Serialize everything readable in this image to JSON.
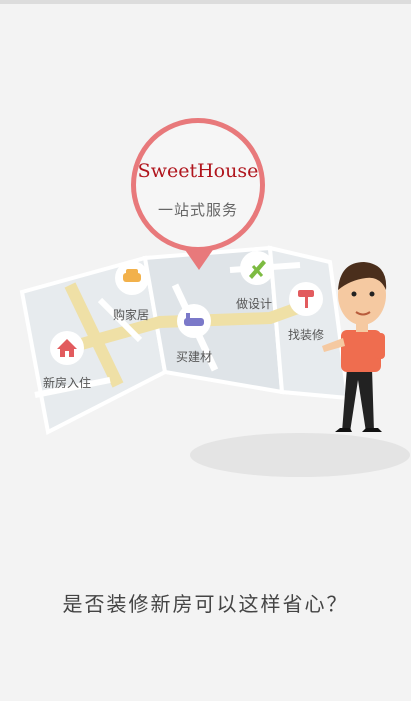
{
  "brand": {
    "title": "SweetHouse",
    "slogan": "一站式服务"
  },
  "map_points": [
    {
      "label": "购家居",
      "icon": "sofa-icon",
      "color": "#f2b14b"
    },
    {
      "label": "做设计",
      "icon": "design-tools-icon",
      "color": "#7dbb42"
    },
    {
      "label": "买建材",
      "icon": "bathtub-icon",
      "color": "#7b79c9"
    },
    {
      "label": "找装修",
      "icon": "paint-roller-icon",
      "color": "#e25b5e"
    },
    {
      "label": "新房入住",
      "icon": "house-icon",
      "color": "#e25b5e"
    }
  ],
  "headline": "是否装修新房可以这样省心？",
  "colors": {
    "accent": "#e8797b",
    "brand": "#b0151d",
    "background": "#f3f3f3"
  }
}
